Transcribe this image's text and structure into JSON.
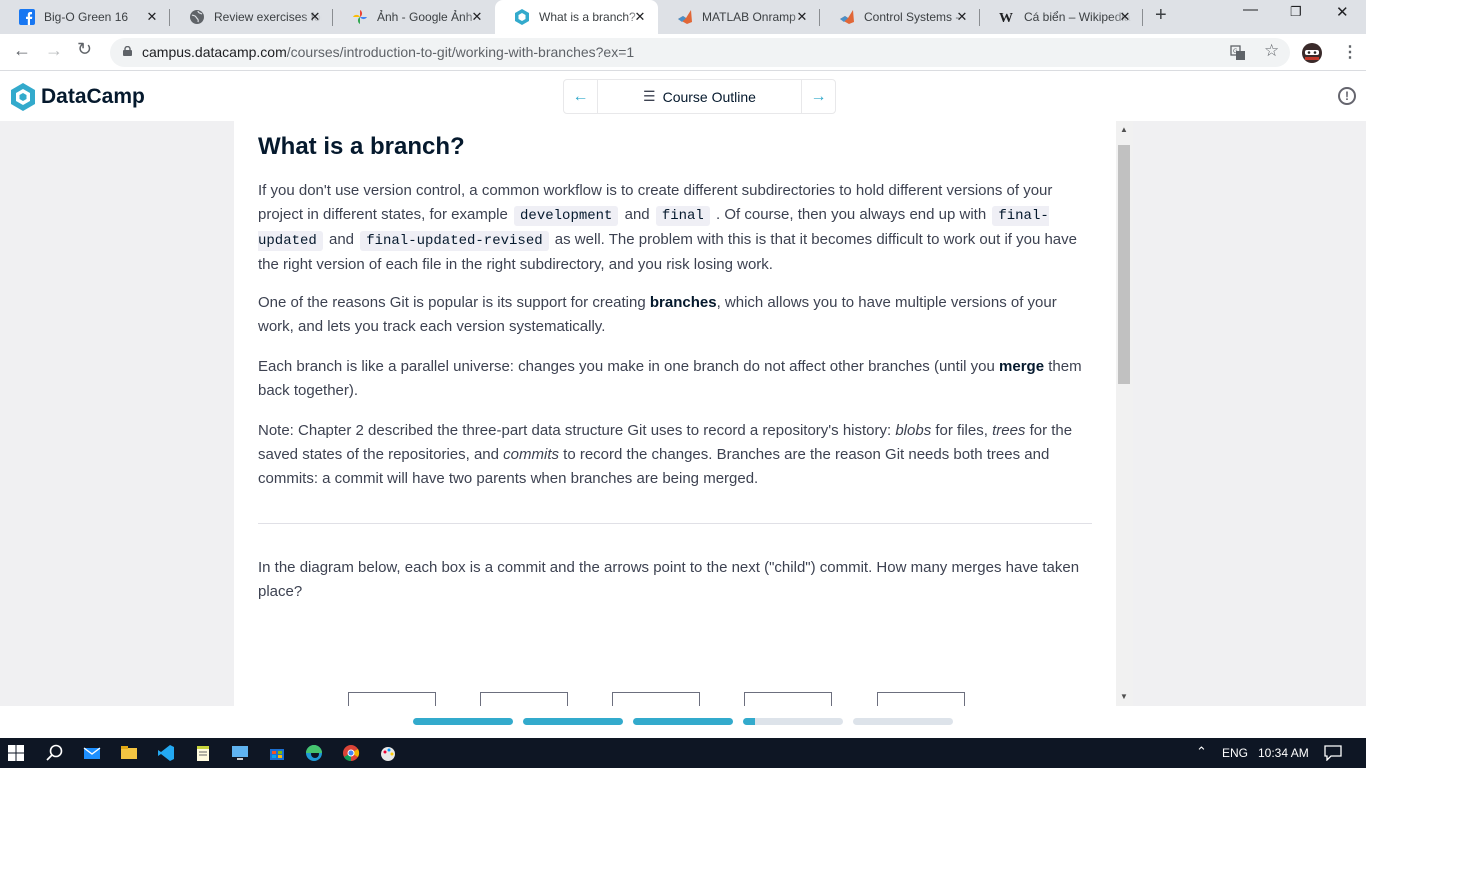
{
  "browser": {
    "tabs": [
      {
        "title": "Big-O Green 16",
        "icon": "facebook-icon"
      },
      {
        "title": "Review exercises for",
        "icon": "globe-icon"
      },
      {
        "title": "Ảnh - Google Ảnh",
        "icon": "google-photos-icon"
      },
      {
        "title": "What is a branch?",
        "icon": "datacamp-icon",
        "active": true
      },
      {
        "title": "MATLAB Onramp",
        "icon": "matlab-icon"
      },
      {
        "title": "Control Systems -",
        "icon": "matlab-icon"
      },
      {
        "title": "Cá biển – Wikipedia",
        "icon": "wikipedia-icon"
      }
    ],
    "close_glyph": "✕",
    "new_tab": "+",
    "url_host": "campus.datacamp.com",
    "url_path": "/courses/introduction-to-git/working-with-branches?ex=1"
  },
  "header": {
    "logo_text": "DataCamp",
    "course_outline": "Course Outline"
  },
  "content": {
    "title": "What is a branch?",
    "p1": {
      "t1": "If you don't use version control, a common workflow is to create different subdirectories to hold different versions of your project in different states, for example",
      "c1": "development",
      "t2": "and",
      "c2": "final",
      "t3": ". Of course, then you always end up with",
      "c3": "final-updated",
      "t4": "and",
      "c4": "final-updated-revised",
      "t5": "as well. The problem with this is that it becomes difficult to work out if you have the right version of each file in the right subdirectory, and you risk losing work."
    },
    "p2": {
      "t1": "One of the reasons Git is popular is its support for creating",
      "b1": "branches",
      "t2": ", which allows you to have multiple versions of your work, and lets you track each version systematically."
    },
    "p3": {
      "t1": "Each branch is like a parallel universe: changes you make in one branch do not affect other branches (until you",
      "b1": "merge",
      "t2": "them back together)."
    },
    "p4": {
      "t1": "Note: Chapter 2 described the three-part data structure Git uses to record a repository's history:",
      "i1": "blobs",
      "t2": "for files,",
      "i2": "trees",
      "t3": "for the saved states of the repositories, and",
      "i3": "commits",
      "t4": "to record the changes. Branches are the reason Git needs both trees and commits: a commit will have two parents when branches are being merged."
    },
    "question": "In the diagram below, each box is a commit and the arrows point to the next (\"child\") commit. How many merges have taken place?"
  },
  "progress": {
    "segments": 5,
    "completed": 3,
    "current_fraction": 0.12,
    "accent": "#33aacc",
    "track": "#dde3ea"
  },
  "taskbar": {
    "lang": "ENG",
    "time": "10:34 AM"
  }
}
